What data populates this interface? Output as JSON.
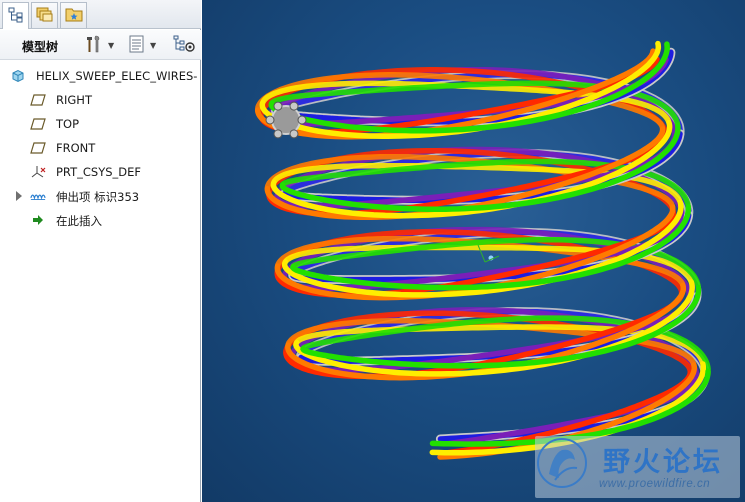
{
  "panel": {
    "tabs": [
      {
        "icon": "model-tree-icon"
      },
      {
        "icon": "folder-browser-icon"
      },
      {
        "icon": "favorites-icon"
      }
    ],
    "toolbar": {
      "title": "模型树",
      "tools_icon": "tools-icon",
      "show_icon": "show-list-icon",
      "settings_icon": "tree-settings-icon"
    },
    "tree": {
      "root": {
        "label": "HELIX_SWEEP_ELEC_WIRES-",
        "icon": "part-icon"
      },
      "items": [
        {
          "label": "RIGHT",
          "icon": "datum-plane-icon"
        },
        {
          "label": "TOP",
          "icon": "datum-plane-icon"
        },
        {
          "label": "FRONT",
          "icon": "datum-plane-icon"
        },
        {
          "label": "PRT_CSYS_DEF",
          "icon": "csys-icon"
        },
        {
          "label": "伸出项 标识353",
          "icon": "protrusion-icon"
        },
        {
          "label": "在此插入",
          "icon": "insert-here-arrow-icon"
        }
      ]
    }
  },
  "viewport": {
    "background_color": "#1a4d82",
    "wire_colors": [
      "#1d1de0",
      "#7a1fb8",
      "#ff2a00",
      "#ff7a00",
      "#ffee00",
      "#22e000",
      "#c9c9c9"
    ]
  },
  "watermark": {
    "title": "野火论坛",
    "url": "www.proewildfire.cn"
  }
}
